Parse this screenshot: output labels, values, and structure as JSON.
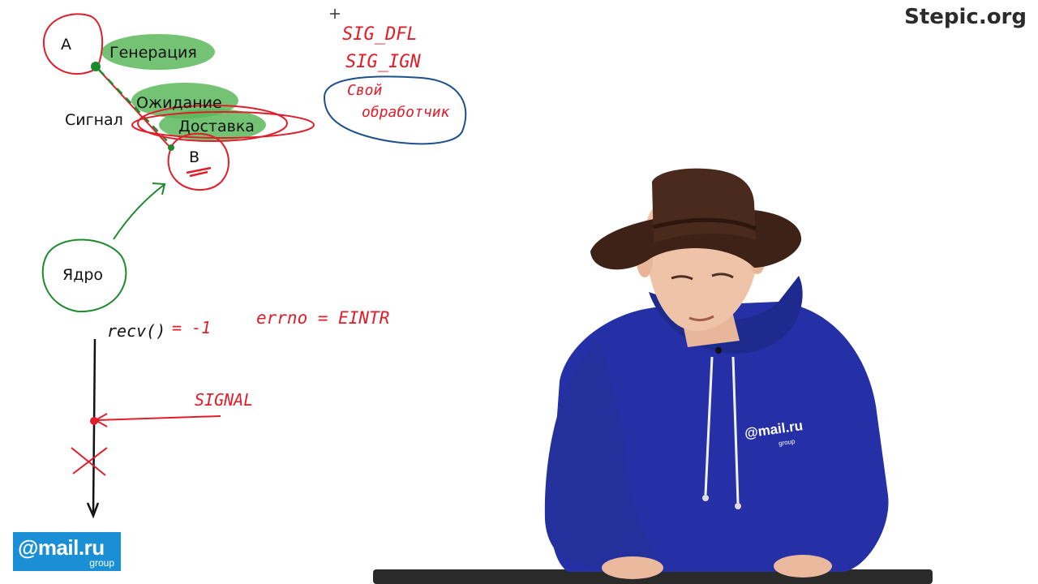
{
  "brand": {
    "site": "Stepic.org"
  },
  "logo": {
    "main": "@mail.ru",
    "sub": "group"
  },
  "diagram": {
    "process_a": "A",
    "process_b": "B",
    "kernel": "Ядро",
    "signal": "Сигнал",
    "stage_generation": "Генерация",
    "stage_waiting": "Ожидание",
    "stage_delivery": "Доставка"
  },
  "handwriting": {
    "sig_dfl": "SIG_DFL",
    "sig_ign": "SIG_IGN",
    "own_handler_line1": "Свой",
    "own_handler_line2": "обработчик",
    "recv_call": "recv()",
    "recv_result": "= -1",
    "errno": "errno = EINTR",
    "signal_word": "SIGNAL"
  },
  "presenter": {
    "shirt_logo": "@mail.ru",
    "shirt_sub": "group"
  },
  "colors": {
    "ink_red": "#e11d2a",
    "ink_green": "#1c8a2c",
    "ink_blue": "#1d4f8a",
    "highlight_green": "#5cb85c",
    "hoodie": "#2530a6",
    "hat": "#4a2a1c",
    "brand_blue": "#1a8fd6"
  }
}
